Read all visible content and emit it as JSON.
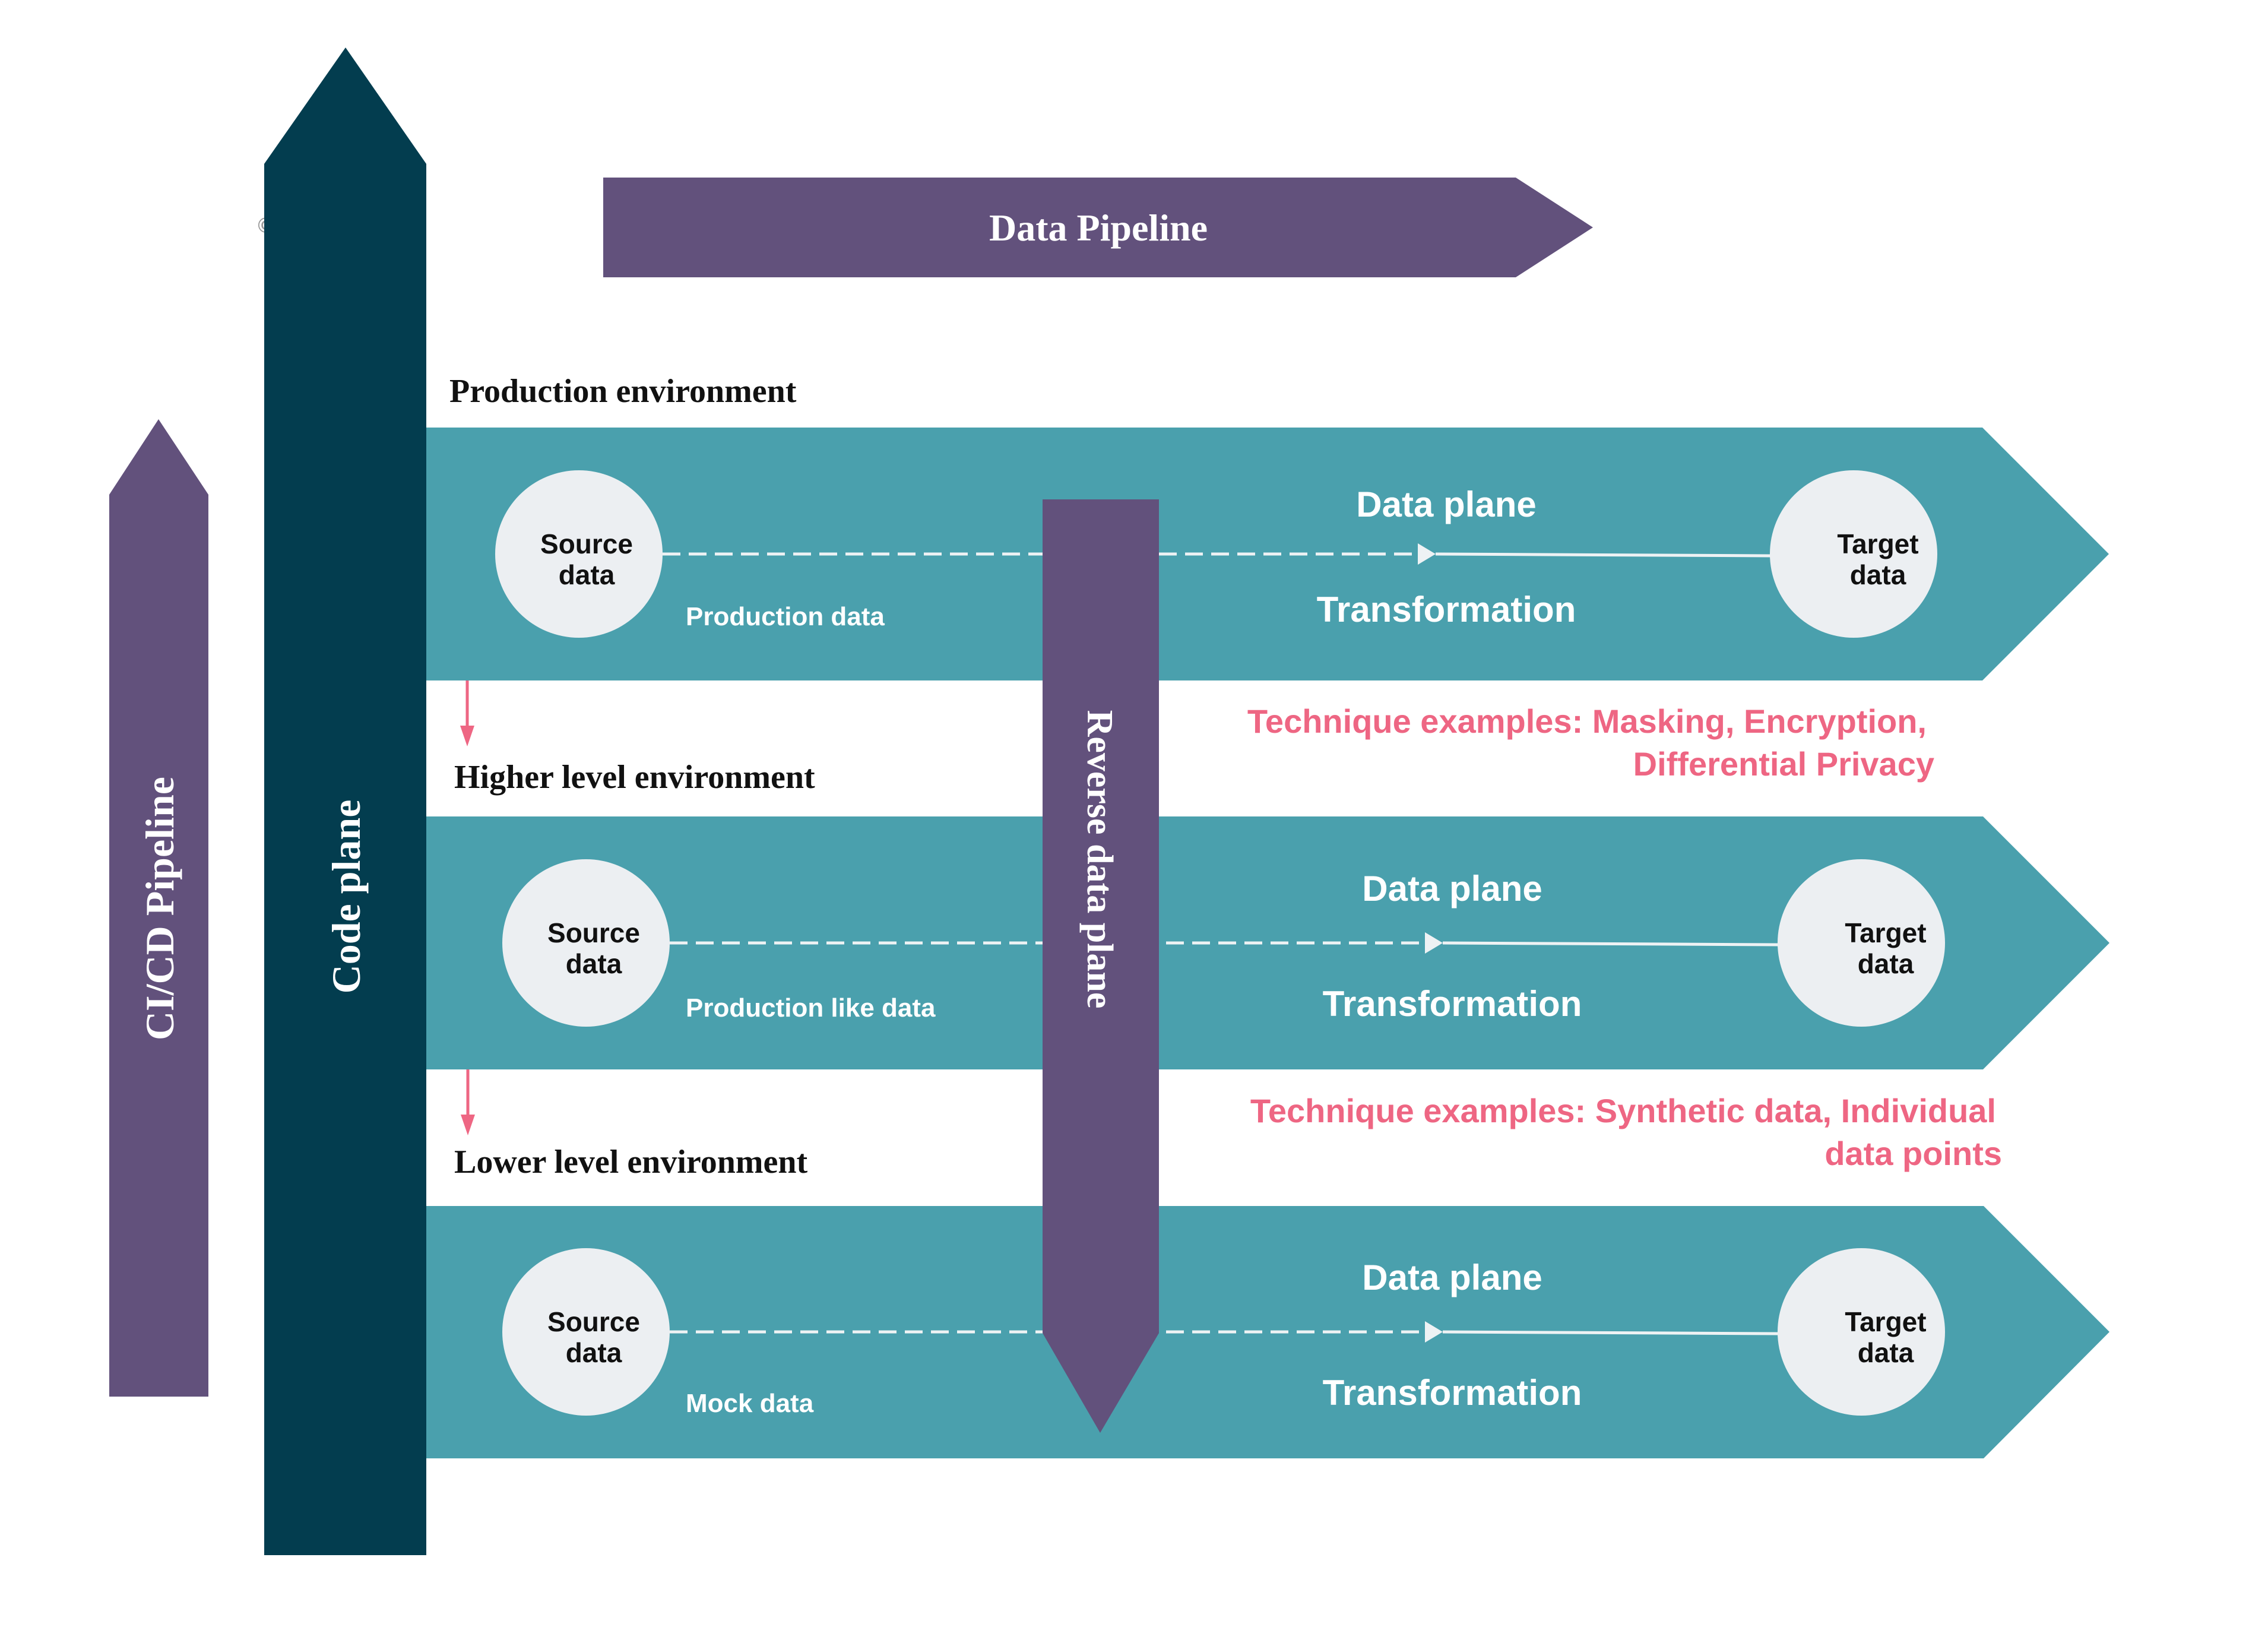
{
  "colors": {
    "teal_band": "#4AA0AD",
    "code_plane": "#033D4F",
    "purple": "#62517C",
    "pink_accent": "#EE6683",
    "node_fill": "#ECEFF2",
    "line_white": "#EEF2F4"
  },
  "data_pipeline": {
    "label": "Data Pipeline"
  },
  "cicd_pipeline": {
    "label": "CI/CD Pipeline"
  },
  "code_plane": {
    "label": "Code plane"
  },
  "reverse_data_plane": {
    "label": "Reverse data plane"
  },
  "copyright_mark": "©",
  "environments": [
    {
      "heading": "Production environment",
      "source": {
        "line1": "Source",
        "line2": "data"
      },
      "target": {
        "line1": "Target",
        "line2": "data"
      },
      "data_label": "Production data",
      "plane_label": "Data plane",
      "transform_label": "Transformation"
    },
    {
      "heading": "Higher level environment",
      "source": {
        "line1": "Source",
        "line2": "data"
      },
      "target": {
        "line1": "Target",
        "line2": "data"
      },
      "data_label": "Production like data",
      "plane_label": "Data plane",
      "transform_label": "Transformation"
    },
    {
      "heading": "Lower level environment",
      "source": {
        "line1": "Source",
        "line2": "data"
      },
      "target": {
        "line1": "Target",
        "line2": "data"
      },
      "data_label": "Mock data",
      "plane_label": "Data plane",
      "transform_label": "Transformation"
    }
  ],
  "techniques": [
    {
      "line1": "Technique examples: Masking, Encryption,",
      "line2": "Differential Privacy"
    },
    {
      "line1": "Technique examples: Synthetic data, Individual",
      "line2": "data points"
    }
  ]
}
